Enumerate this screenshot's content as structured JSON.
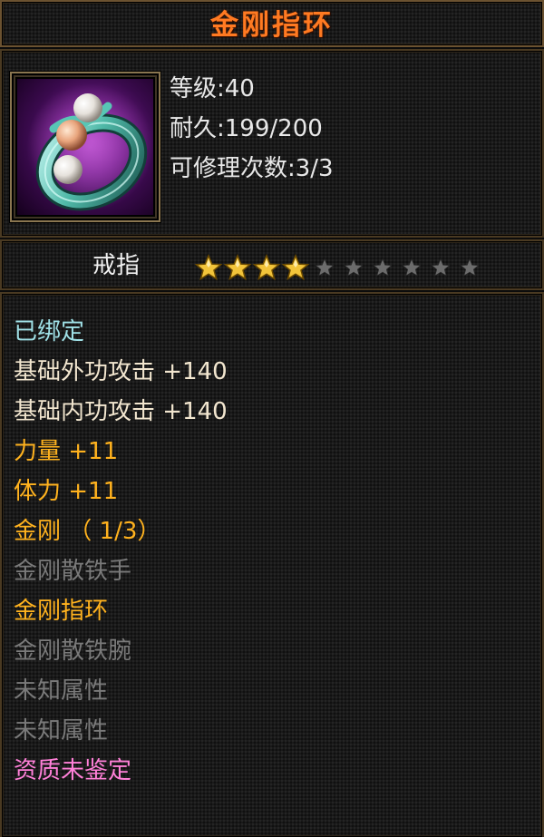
{
  "item": {
    "name": "金刚指环",
    "icon": "ring-icon",
    "stats": [
      "等级:40",
      "耐久:199/200",
      "可修理次数:3/3"
    ],
    "type": "戒指",
    "star_rating": 4,
    "star_max": 10,
    "attributes": [
      {
        "text": "已绑定",
        "color": "#9fe0e6"
      },
      {
        "text": "基础外功攻击 +140",
        "color": "#f2e6cf"
      },
      {
        "text": "基础内功攻击 +140",
        "color": "#f2e6cf"
      },
      {
        "text": "力量 +11",
        "color": "#ffb21e"
      },
      {
        "text": "体力 +11",
        "color": "#ffb21e"
      },
      {
        "text": "金刚 （ 1/3）",
        "color": "#ffb21e"
      },
      {
        "text": "金刚散铁手",
        "color": "#7a7a7a"
      },
      {
        "text": "金刚指环",
        "color": "#ffb21e"
      },
      {
        "text": "金刚散铁腕",
        "color": "#7a7a7a"
      },
      {
        "text": "未知属性",
        "color": "#7a7a7a"
      },
      {
        "text": "未知属性",
        "color": "#7a7a7a"
      },
      {
        "text": "资质未鉴定",
        "color": "#ff80d8"
      }
    ]
  },
  "colors": {
    "title": "#ff7a22",
    "star_filled": "#f2c43a",
    "star_empty": "#6c6c6c",
    "frame": "#4a3a22"
  }
}
